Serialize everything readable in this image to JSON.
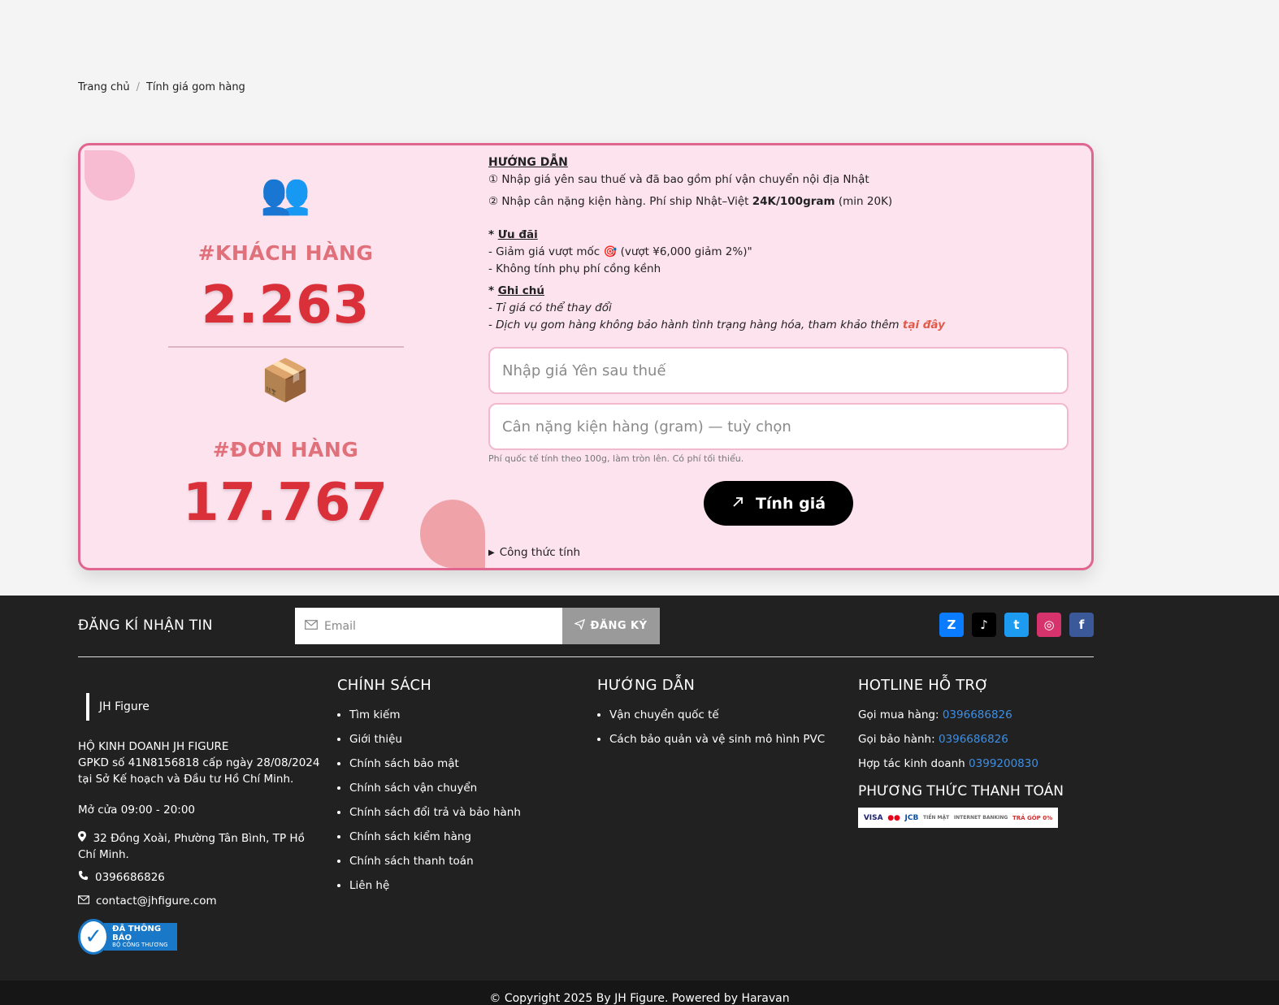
{
  "breadcrumb": {
    "home": "Trang chủ",
    "separator": "/",
    "current": "Tính giá gom hàng"
  },
  "stats": {
    "customers": {
      "icon": "👥",
      "label": "#KHÁCH HÀNG",
      "value": "2.263"
    },
    "orders": {
      "icon": "📦",
      "label": "#ĐƠN HÀNG",
      "value": "17.767"
    }
  },
  "guide": {
    "title": "HƯỚNG DẪN",
    "step1": "① Nhập giá yên sau thuế và đã bao gồm phí vận chuyển nội địa Nhật",
    "step2_pre": "② Nhập cân nặng kiện hàng. Phí ship Nhật–Việt ",
    "step2_bold": "24K/100gram",
    "step2_post": " (min 20K)",
    "offer_title": "Ưu đãi",
    "offer1": "- Giảm giá vượt mốc 🎯 (vượt ¥6,000 giảm 2%)\"",
    "offer2": "- Không tính phụ phí cồng kềnh",
    "note_title": "Ghi chú",
    "note1": "- Tỉ giá có thể thay đổi",
    "note2": "- Dịch vụ gom hàng không bảo hành tình trạng hàng hóa, tham khảo thêm ",
    "note2_link": "tại đây"
  },
  "form": {
    "yen_placeholder": "Nhập giá Yên sau thuế",
    "weight_placeholder": "Cân nặng kiện hàng (gram) — tuỳ chọn",
    "hint": "Phí quốc tế tính theo 100g, làm tròn lên. Có phí tối thiểu.",
    "calc_label": "Tính giá",
    "formula_label": "Công thức tính"
  },
  "newsletter": {
    "title": "ĐĂNG KÍ NHẬN TIN",
    "email_placeholder": "Email",
    "button": "ĐĂNG KÝ"
  },
  "socials": [
    {
      "name": "Zalo",
      "glyph": "Z",
      "color": "#0a7cff"
    },
    {
      "name": "TikTok",
      "glyph": "♪",
      "color": "#000000"
    },
    {
      "name": "Twitter",
      "glyph": "t",
      "color": "#1d9bf0"
    },
    {
      "name": "Instagram",
      "glyph": "◎",
      "color": "#d6336c"
    },
    {
      "name": "Facebook",
      "glyph": "f",
      "color": "#3b5998"
    }
  ],
  "footer": {
    "brand": "JH Figure",
    "company_name": "HỘ KINH DOANH JH FIGURE",
    "company_reg": "GPKD số 41N8156818 cấp ngày 28/08/2024 tại Sở Kế hoạch và Đầu tư Hồ Chí Minh.",
    "opening": "Mở cửa 09:00 - 20:00",
    "address": "32 Đồng Xoài, Phường Tân Bình, TP Hồ Chí Minh.",
    "phone": "0396686826",
    "email": "contact@jhfigure.com",
    "badge_line1": "ĐÃ THÔNG BÁO",
    "badge_line2": "BỘ CÔNG THƯƠNG",
    "policy_title": "CHÍNH SÁCH",
    "policy_items": [
      "Tìm kiếm",
      "Giới thiệu",
      "Chính sách bảo mật",
      "Chính sách vận chuyển",
      "Chính sách đổi trả và bảo hành",
      "Chính sách kiểm hàng",
      "Chính sách thanh toán",
      "Liên hệ"
    ],
    "guide_title": "HƯỚNG DẪN",
    "guide_items": [
      "Vận chuyển quốc tế",
      "Cách bảo quản và vệ sinh mô hình PVC"
    ],
    "hotline_title": "HOTLINE HỖ TRỢ",
    "hotline_buy_label": "Gọi mua hàng:",
    "hotline_buy": "0396686826",
    "hotline_warranty_label": "Gọi bảo hành:",
    "hotline_warranty": "0396686826",
    "hotline_biz_label": "Hợp tác kinh doanh",
    "hotline_biz": "0399200830",
    "payment_title": "PHƯƠNG THỨC THANH TOÁN",
    "payment_methods": [
      "VISA",
      "●●",
      "JCB",
      "TIỀN MẶT",
      "INTERNET BANKING",
      "TRẢ GÓP 0%"
    ]
  },
  "copyright": "© Copyright 2025 By JH Figure. Powered by Haravan"
}
